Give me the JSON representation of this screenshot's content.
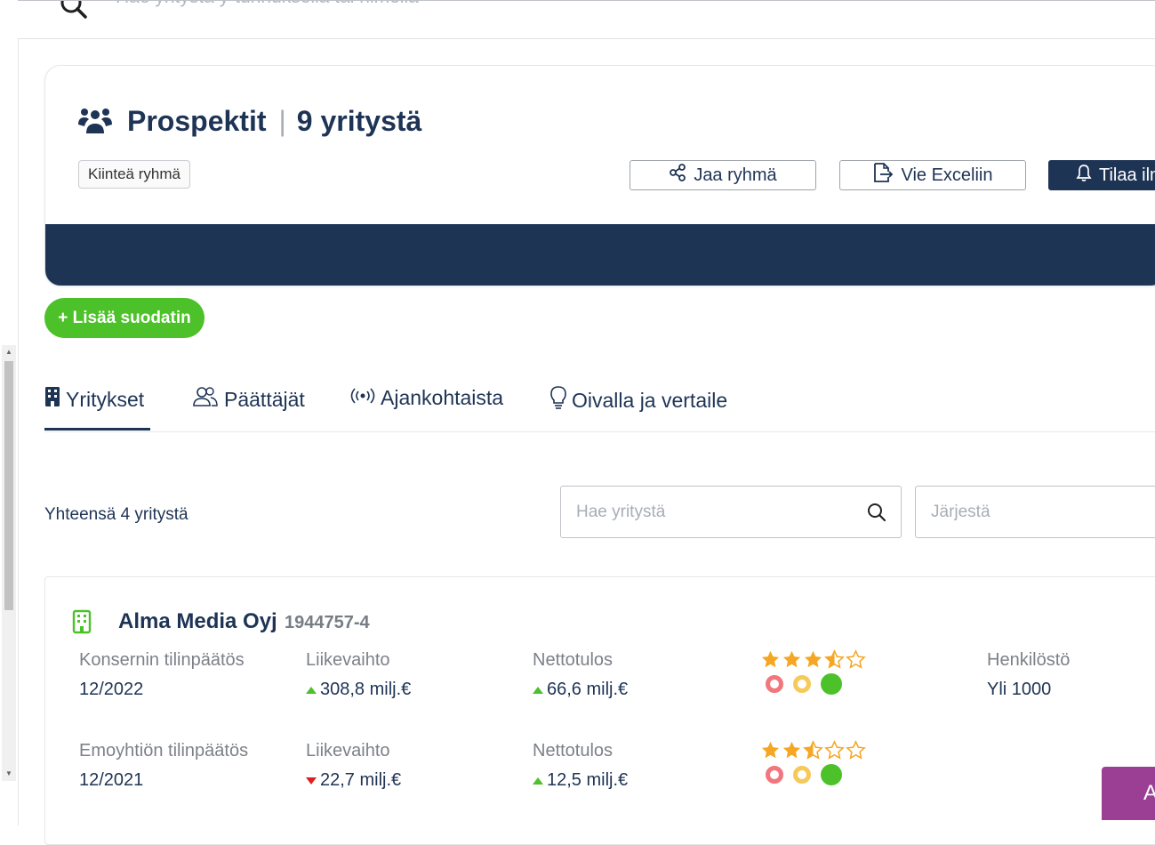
{
  "top_search": {
    "placeholder": "Hae yritystä y-tunnuksella tai nimellä"
  },
  "group": {
    "title": "Prospektit",
    "count_label": "9 yritystä",
    "badge": "Kiinteä ryhmä",
    "buttons": {
      "share": "Jaa ryhmä",
      "export": "Vie Exceliin",
      "subscribe": "Tilaa ilm"
    }
  },
  "add_filter": "+ Lisää suodatin",
  "tabs": [
    {
      "label": "Yritykset",
      "active": true
    },
    {
      "label": "Päättäjät",
      "active": false
    },
    {
      "label": "Ajankohtaista",
      "active": false
    },
    {
      "label": "Oivalla ja vertaile",
      "active": false
    }
  ],
  "list": {
    "total": "Yhteensä 4 yritystä",
    "search_placeholder": "Hae yritystä",
    "sort_placeholder": "Järjestä"
  },
  "company": {
    "name": "Alma Media Oyj",
    "business_id": "1944757-4",
    "rows": [
      {
        "statement_label": "Konsernin tilinpäätös",
        "period": "12/2022",
        "revenue_label": "Liikevaihto",
        "revenue": "308,8 milj.€",
        "revenue_trend": "up",
        "net_label": "Nettotulos",
        "net": "66,6 milj.€",
        "net_trend": "up",
        "rating_stars": 3.5,
        "staff_label": "Henkilöstö",
        "staff": "Yli 1000"
      },
      {
        "statement_label": "Emoyhtiön tilinpäätös",
        "period": "12/2021",
        "revenue_label": "Liikevaihto",
        "revenue": "22,7 milj.€",
        "revenue_trend": "down",
        "net_label": "Nettotulos",
        "net": "12,5 milj.€",
        "net_trend": "up",
        "rating_stars": 2.5
      }
    ]
  },
  "chat_button": "A",
  "colors": {
    "navy": "#1e3455",
    "green": "#4dc12a",
    "star": "#f5a623",
    "purple": "#9b3f95"
  }
}
